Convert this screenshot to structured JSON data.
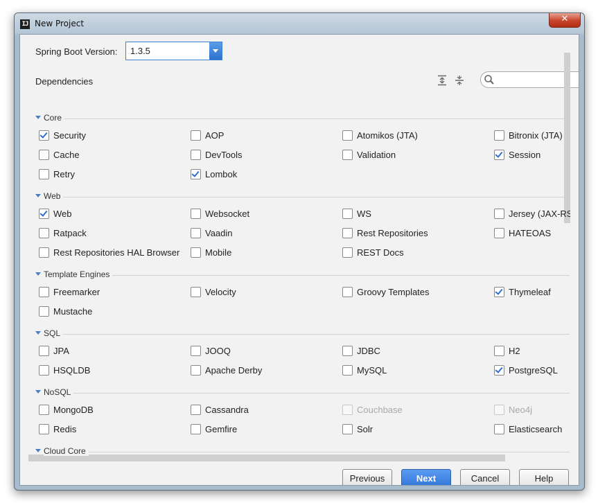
{
  "window": {
    "title": "New Project",
    "app_icon": "IJ",
    "close_symbol": "✕"
  },
  "boot": {
    "label": "Spring Boot Version:",
    "value": "1.3.5"
  },
  "dependencies": {
    "label": "Dependencies",
    "search_placeholder": ""
  },
  "sections": {
    "core": "Core",
    "web": "Web",
    "template": "Template Engines",
    "sql": "SQL",
    "nosql": "NoSQL",
    "cloud": "Cloud Core"
  },
  "items": {
    "security": {
      "label": "Security",
      "checked": true
    },
    "aop": {
      "label": "AOP",
      "checked": false
    },
    "atomikos": {
      "label": "Atomikos (JTA)",
      "checked": false
    },
    "bitronix": {
      "label": "Bitronix (JTA)",
      "checked": false
    },
    "cache": {
      "label": "Cache",
      "checked": false
    },
    "devtools": {
      "label": "DevTools",
      "checked": false
    },
    "validation": {
      "label": "Validation",
      "checked": false
    },
    "session": {
      "label": "Session",
      "checked": true
    },
    "retry": {
      "label": "Retry",
      "checked": false
    },
    "lombok": {
      "label": "Lombok",
      "checked": true
    },
    "web": {
      "label": "Web",
      "checked": true
    },
    "websocket": {
      "label": "Websocket",
      "checked": false
    },
    "ws": {
      "label": "WS",
      "checked": false
    },
    "jersey": {
      "label": "Jersey (JAX-RS)",
      "checked": false
    },
    "ratpack": {
      "label": "Ratpack",
      "checked": false
    },
    "vaadin": {
      "label": "Vaadin",
      "checked": false
    },
    "rest_repos": {
      "label": "Rest Repositories",
      "checked": false
    },
    "hateoas": {
      "label": "HATEOAS",
      "checked": false
    },
    "rest_hal": {
      "label": "Rest Repositories HAL Browser",
      "checked": false
    },
    "mobile": {
      "label": "Mobile",
      "checked": false
    },
    "rest_docs": {
      "label": "REST Docs",
      "checked": false
    },
    "freemarker": {
      "label": "Freemarker",
      "checked": false
    },
    "velocity": {
      "label": "Velocity",
      "checked": false
    },
    "groovy": {
      "label": "Groovy Templates",
      "checked": false
    },
    "thymeleaf": {
      "label": "Thymeleaf",
      "checked": true
    },
    "mustache": {
      "label": "Mustache",
      "checked": false
    },
    "jpa": {
      "label": "JPA",
      "checked": false
    },
    "jooq": {
      "label": "JOOQ",
      "checked": false
    },
    "jdbc": {
      "label": "JDBC",
      "checked": false
    },
    "h2": {
      "label": "H2",
      "checked": false
    },
    "hsqldb": {
      "label": "HSQLDB",
      "checked": false
    },
    "derby": {
      "label": "Apache Derby",
      "checked": false
    },
    "mysql": {
      "label": "MySQL",
      "checked": false
    },
    "postgresql": {
      "label": "PostgreSQL",
      "checked": true
    },
    "mongodb": {
      "label": "MongoDB",
      "checked": false
    },
    "cassandra": {
      "label": "Cassandra",
      "checked": false
    },
    "couchbase": {
      "label": "Couchbase",
      "checked": false,
      "disabled": true
    },
    "neo4j": {
      "label": "Neo4j",
      "checked": false,
      "disabled": true
    },
    "redis": {
      "label": "Redis",
      "checked": false
    },
    "gemfire": {
      "label": "Gemfire",
      "checked": false
    },
    "solr": {
      "label": "Solr",
      "checked": false
    },
    "elasticsearch": {
      "label": "Elasticsearch",
      "checked": false
    }
  },
  "buttons": {
    "previous": "Previous",
    "next": "Next",
    "cancel": "Cancel",
    "help": "Help"
  },
  "colors": {
    "accent": "#2f73d8",
    "title_bar": "#b4c6d6",
    "close": "#c7432a"
  }
}
